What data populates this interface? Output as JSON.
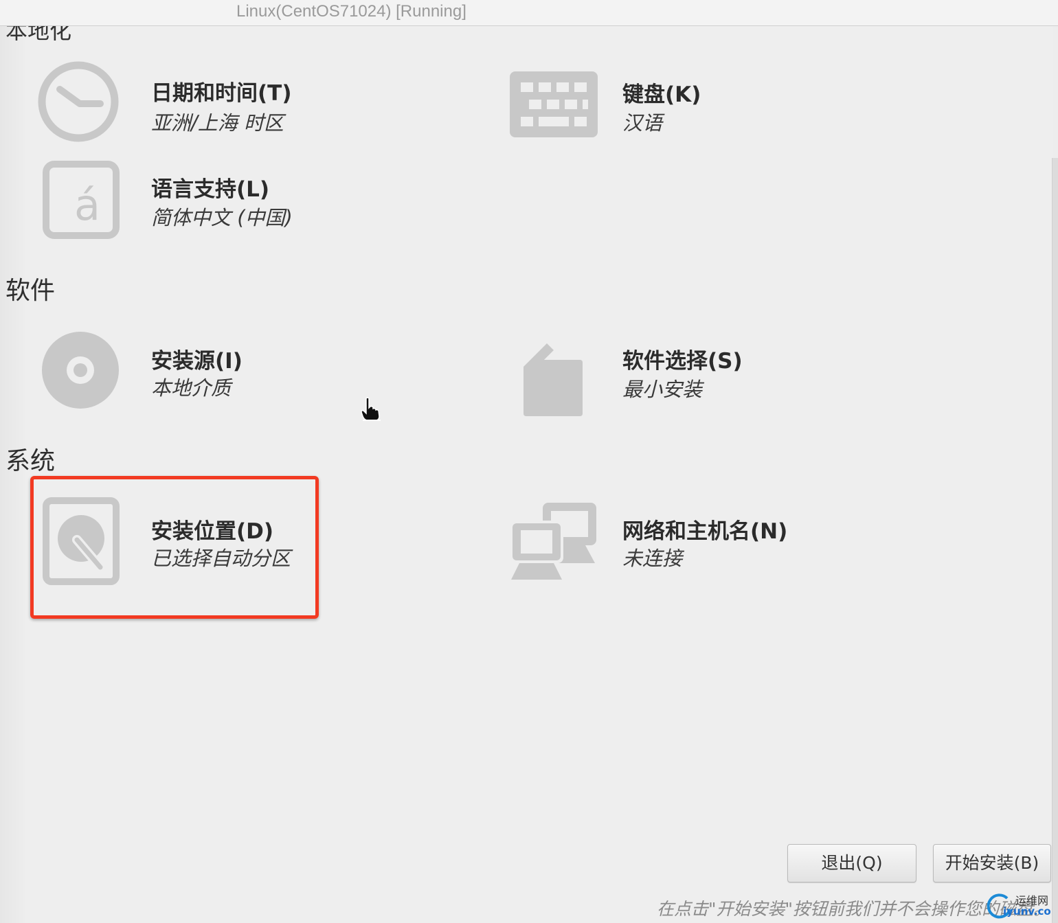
{
  "window": {
    "title": "Linux(CentOS71024) [Running]"
  },
  "sections": {
    "localization_partial": "本地化",
    "software": "软件",
    "system": "系统"
  },
  "spokes": {
    "datetime": {
      "name": "日期和时间(T)",
      "status": "亚洲/上海 时区",
      "icon": "clock-icon"
    },
    "keyboard": {
      "name": "键盘(K)",
      "status": "汉语",
      "icon": "keyboard-icon"
    },
    "language": {
      "name": "语言支持(L)",
      "status": "简体中文 (中国)",
      "icon": "language-icon"
    },
    "source": {
      "name": "安装源(I)",
      "status": "本地介质",
      "icon": "disc-icon"
    },
    "software": {
      "name": "软件选择(S)",
      "status": "最小安装",
      "icon": "package-icon"
    },
    "destination": {
      "name": "安装位置(D)",
      "status": "已选择自动分区",
      "icon": "harddisk-icon"
    },
    "network": {
      "name": "网络和主机名(N)",
      "status": "未连接",
      "icon": "network-icon"
    }
  },
  "buttons": {
    "quit": "退出(Q)",
    "begin": "开始安装(B)"
  },
  "footer_note": "在点击\"开始安装\"按钮前我们并不会操作您的磁盘。",
  "watermark": {
    "line1": "运维网",
    "line2": "iyunv.com"
  },
  "colors": {
    "icon_gray": "#c8c8c8",
    "highlight_red": "#f23a22"
  }
}
